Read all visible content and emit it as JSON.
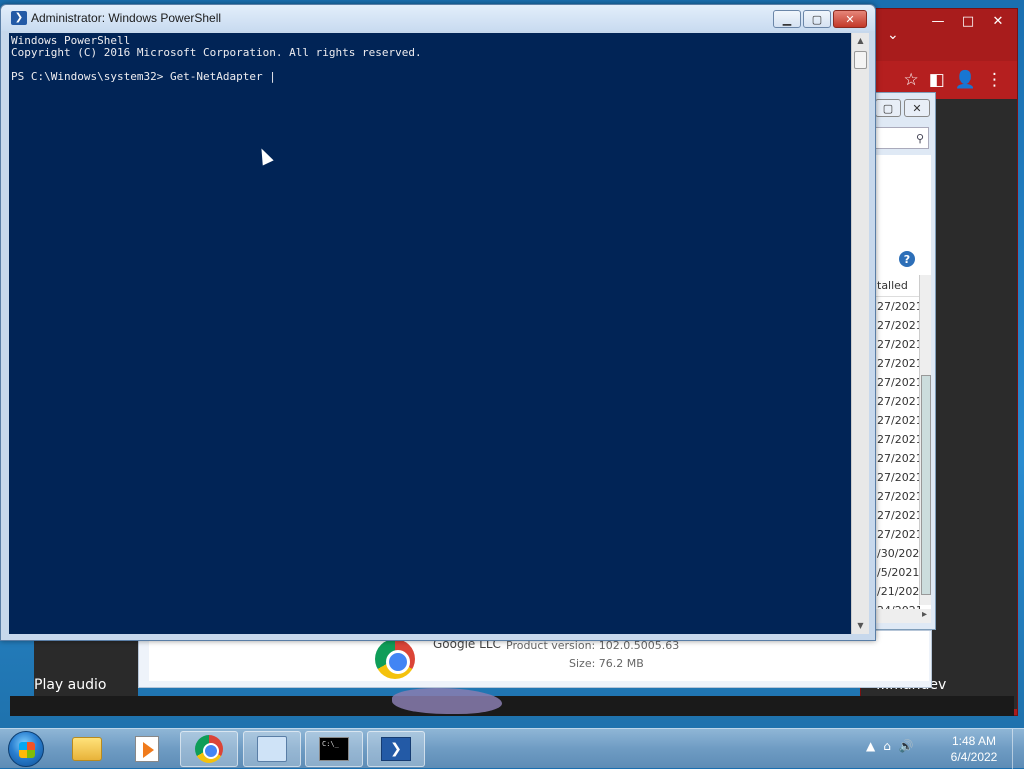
{
  "powershell": {
    "title": "Administrator: Windows PowerShell",
    "icon": "powershell-icon",
    "minimize_label": "▁",
    "maximize_label": "▢",
    "close_label": "✕",
    "console_lines": [
      "Windows PowerShell",
      "Copyright (C) 2016 Microsoft Corporation. All rights reserved.",
      "",
      "PS C:\\Windows\\system32> Get-NetAdapter |"
    ]
  },
  "chrome": {
    "minimize": "—",
    "restore": "□",
    "close": "✕",
    "tabs_dropdown": "⌄",
    "toolbar_icons": [
      "star-icon",
      "reader-mode-icon",
      "profile-icon",
      "menu-icon"
    ],
    "toolbar_glyphs": [
      "☆",
      "◧",
      "👤",
      "⋮"
    ]
  },
  "explorer": {
    "restore": "▢",
    "close": "✕",
    "search_glyph": "⚲",
    "help_glyph": "?",
    "list_header": "talled",
    "list_rows": [
      "27/2021",
      "27/2021",
      "27/2021",
      "27/2021",
      "27/2021",
      "27/2021",
      "27/2021",
      "27/2021",
      "27/2021",
      "27/2021",
      "27/2021",
      "27/2021",
      "27/2021",
      "/30/202",
      "/5/2021",
      "/21/202",
      "24/2021"
    ],
    "scroll_right": "▸"
  },
  "setup_panel": {
    "publisher": "Google LLC",
    "product_version": "Product version:  102.0.5005.63",
    "size": "Size:  76.2 MB"
  },
  "video": {
    "play_audio": "Play audio",
    "right_caption": "...mandev"
  },
  "taskbar": {
    "apps": [
      {
        "name": "windows-explorer",
        "icon": "folder-icon"
      },
      {
        "name": "media-player",
        "icon": "media-player-icon"
      },
      {
        "name": "google-chrome",
        "icon": "chrome-icon"
      },
      {
        "name": "network-tool",
        "icon": "network-icon"
      },
      {
        "name": "command-prompt",
        "icon": "cmd-icon",
        "glyph": "C:\\_"
      },
      {
        "name": "powershell",
        "icon": "powershell-icon",
        "glyph": "❯"
      }
    ],
    "tray_icons": [
      "▲",
      "⌂",
      "🔊"
    ],
    "time": "1:48 AM",
    "date": "6/4/2022"
  }
}
